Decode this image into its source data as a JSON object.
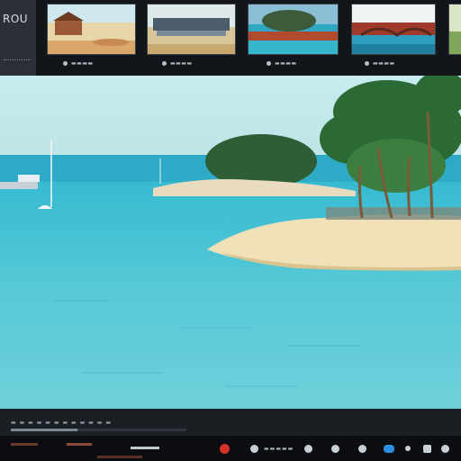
{
  "sidebar": {
    "title": "ROU"
  },
  "filmstrip": {
    "thumbnails": [
      {
        "name": "beach-hut",
        "caption": ""
      },
      {
        "name": "pier-station",
        "caption": ""
      },
      {
        "name": "coastal-fort",
        "caption": ""
      },
      {
        "name": "harbor-bridge",
        "caption": ""
      }
    ]
  },
  "viewer": {
    "scene": "tropical-lagoon"
  },
  "timeline": {
    "progress": 0.38
  },
  "controls": {
    "record_color": "#d6322c",
    "accent_color": "#2d8fe0"
  },
  "colors": {
    "sky": "#bfe6ea",
    "sea": "#4fc3d4",
    "sand": "#f1e3c0",
    "foliage": "#2f6b3a"
  }
}
